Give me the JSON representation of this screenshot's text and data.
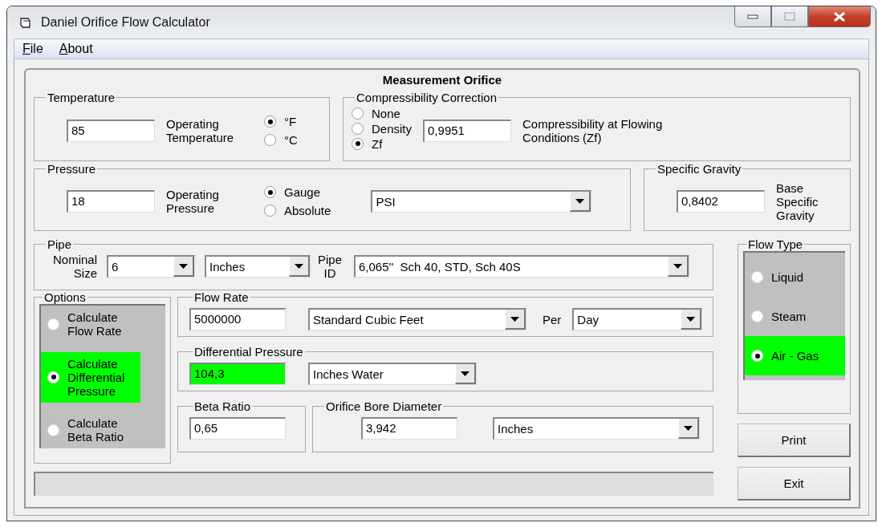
{
  "window": {
    "title": "Daniel Orifice Flow Calculator"
  },
  "menu": [
    {
      "label": "File"
    },
    {
      "label": "About"
    }
  ],
  "panel_title": "Measurement Orifice",
  "temperature": {
    "label": "Temperature",
    "value": "85",
    "caption": "Operating Temperature",
    "units": [
      {
        "label": "°F",
        "selected": true
      },
      {
        "label": "°C",
        "selected": false
      }
    ]
  },
  "compressibility": {
    "label": "Compressibility Correction",
    "options": [
      {
        "label": "None",
        "selected": false
      },
      {
        "label": "Density",
        "selected": false
      },
      {
        "label": "Zf",
        "selected": true
      }
    ],
    "value": "0,9951",
    "caption": "Compressibility at Flowing Conditions (Zf)"
  },
  "pressure": {
    "label": "Pressure",
    "value": "18",
    "caption": "Operating Pressure",
    "modes": [
      {
        "label": "Gauge",
        "selected": true
      },
      {
        "label": "Absolute",
        "selected": false
      }
    ],
    "unit": "PSI"
  },
  "specific_gravity": {
    "label": "Specific Gravity",
    "value": "0,8402",
    "caption": "Base Specific Gravity"
  },
  "pipe": {
    "label": "Pipe",
    "size_caption": "Nominal Size",
    "size": "6",
    "size_unit": "Inches",
    "id_caption": "Pipe ID",
    "id": "6,065''  Sch 40, STD, Sch 40S"
  },
  "options": {
    "label": "Options",
    "items": [
      {
        "label": "Calculate Flow Rate",
        "selected": false
      },
      {
        "label": "Calculate Differential Pressure",
        "selected": true
      },
      {
        "label": "Calculate Beta Ratio",
        "selected": false
      }
    ]
  },
  "flow_rate": {
    "label": "Flow Rate",
    "value": "5000000",
    "unit": "Standard Cubic Feet",
    "per_caption": "Per",
    "per": "Day"
  },
  "differential_pressure": {
    "label": "Differential Pressure",
    "value": "104,3",
    "highlighted": true,
    "unit": "Inches Water"
  },
  "beta_ratio": {
    "label": "Beta Ratio",
    "value": "0,65"
  },
  "orifice_bore": {
    "label": "Orifice Bore Diameter",
    "value": "3,942",
    "unit": "Inches"
  },
  "flow_type": {
    "label": "Flow Type",
    "items": [
      {
        "label": "Liquid",
        "selected": false
      },
      {
        "label": "Steam",
        "selected": false
      },
      {
        "label": "Air - Gas",
        "selected": true
      }
    ]
  },
  "buttons": [
    "Print",
    "Exit"
  ]
}
